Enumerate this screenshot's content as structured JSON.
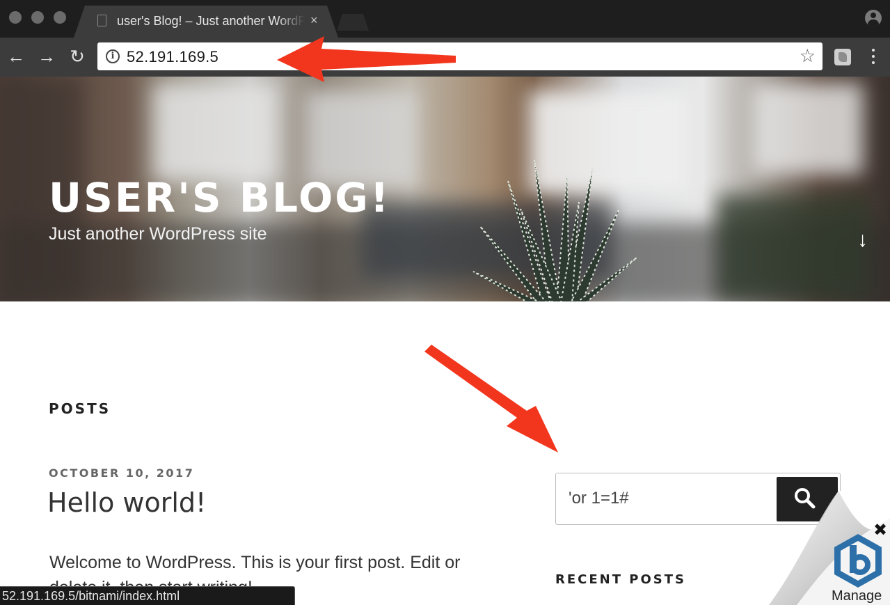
{
  "browser": {
    "tab_title": "user's Blog! – Just another WordPress site",
    "tab_close": "×",
    "address": "52.191.169.5",
    "status_url": "52.191.169.5/bitnami/index.html"
  },
  "nav_glyphs": {
    "back": "←",
    "forward": "→",
    "reload": "↻",
    "star": "☆",
    "info": "i"
  },
  "header": {
    "title": "USER'S BLOG!",
    "tagline": "Just another WordPress site",
    "scroll_glyph": "↓"
  },
  "content": {
    "posts_heading": "POSTS",
    "post_date": "OCTOBER 10, 2017",
    "post_title": "Hello world!",
    "post_excerpt": "Welcome to WordPress. This is your first post. Edit or delete it, then start writing!"
  },
  "sidebar": {
    "search_value": "'or 1=1#",
    "recent_posts_heading": "RECENT POSTS"
  },
  "widget": {
    "label": "Manage",
    "close_glyph": "✖"
  },
  "colors": {
    "annotation_arrow": "#f2361e",
    "search_button": "#222222",
    "bitnami_blue": "#2d6fa8"
  }
}
